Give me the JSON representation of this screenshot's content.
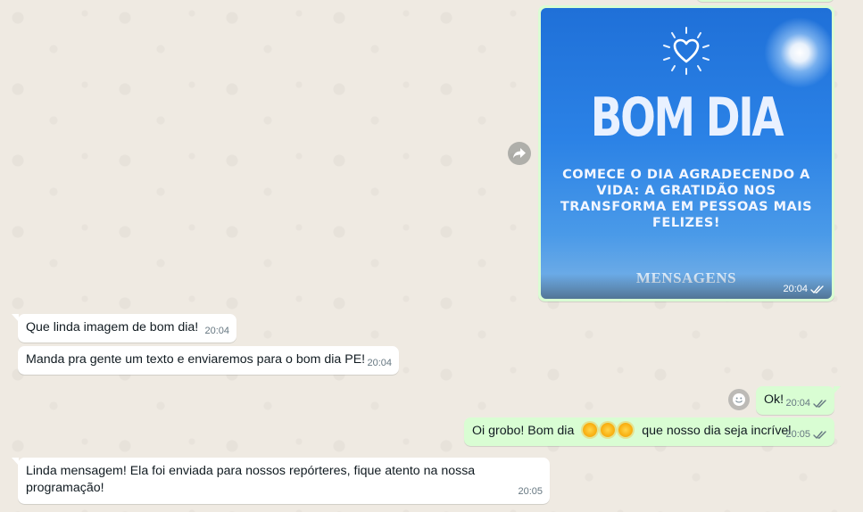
{
  "image_message": {
    "headline": "BOM DIA",
    "subtitle": "COMECE O DIA AGRADECENDO A VIDA: A GRATIDÃO NOS TRANSFORMA EM PESSOAS MAIS FELIZES!",
    "watermark": "MENSAGENS",
    "time": "20:04",
    "forward_icon": "forward-arrow-icon"
  },
  "messages": [
    {
      "text": "Que linda imagem de bom dia!",
      "time": "20:04"
    },
    {
      "text": "Manda pra gente um texto e enviaremos para o bom dia PE!",
      "time": "20:04"
    },
    {
      "text": "Ok!",
      "time": "20:04"
    },
    {
      "text_before": "Oi grobo! Bom dia",
      "text_after": "que nosso dia seja incrível",
      "time": "20:05"
    },
    {
      "text_line1": "Linda mensagem! Ela foi enviada para nossos repórteres, fique atento na nossa",
      "text_line2": "programação!",
      "time": "20:05"
    }
  ],
  "colors": {
    "chat_bg": "#efeae2",
    "incoming_bubble": "#ffffff",
    "outgoing_bubble": "#d9fdd3",
    "read_ticks": "#667781"
  }
}
